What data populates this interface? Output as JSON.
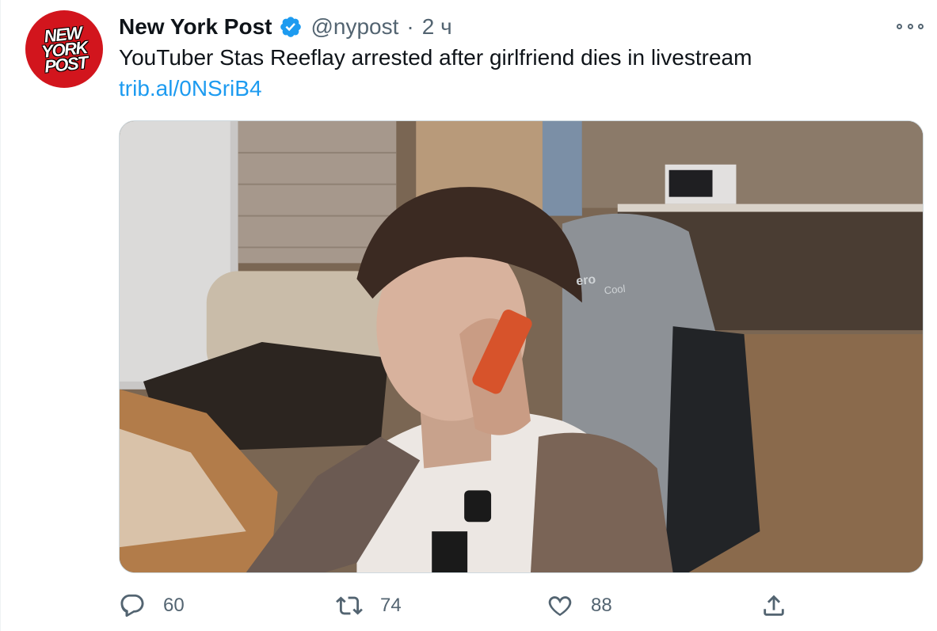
{
  "tweet": {
    "avatar": {
      "logo_lines": [
        "NEW",
        "YORK",
        "POST"
      ],
      "brand_color": "#d2151d"
    },
    "author": {
      "display_name": "New York Post",
      "verified": true,
      "handle": "@nypost",
      "separator": "·",
      "time": "2 ч"
    },
    "text": "YouTuber Stas Reeflay arrested after girlfriend dies in livestream",
    "link": "trib.al/0NSriB4",
    "media": {
      "chair_brand": "ero",
      "chair_brand_sub": "Cool"
    },
    "actions": {
      "reply_count": "60",
      "retweet_count": "74",
      "like_count": "88"
    },
    "icons": [
      "more-icon",
      "verified-badge-icon",
      "reply-icon",
      "retweet-icon",
      "like-icon",
      "share-icon"
    ],
    "colors": {
      "link": "#1d9bf0",
      "secondary_text": "#536471",
      "verified": "#1d9bf0"
    }
  }
}
